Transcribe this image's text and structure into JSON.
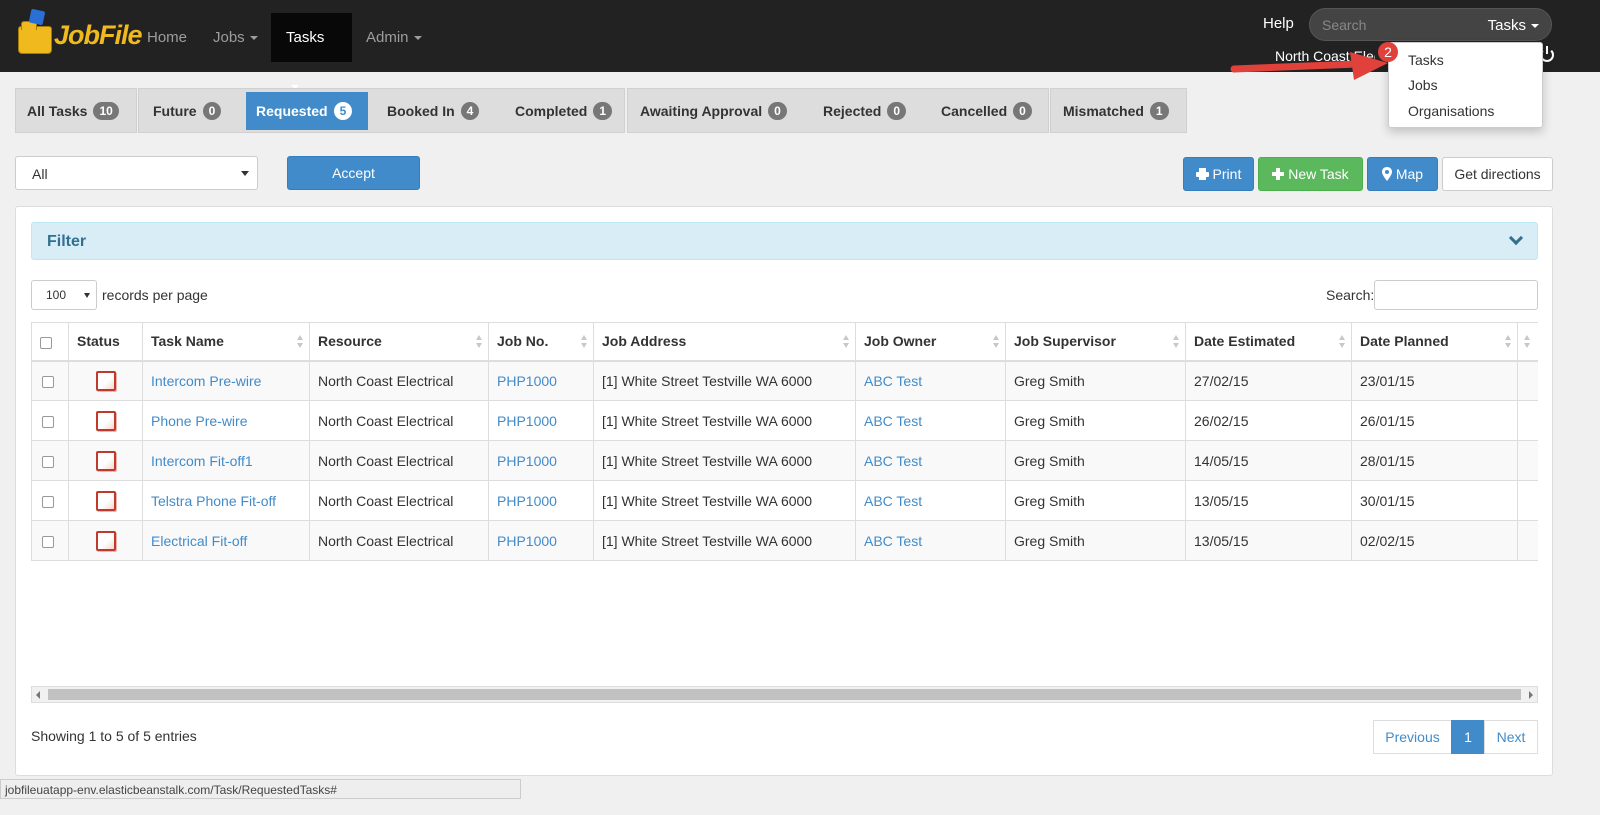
{
  "app": {
    "logo_text": "JobFile"
  },
  "nav": {
    "home": "Home",
    "jobs": "Jobs",
    "tasks": "Tasks",
    "admin": "Admin",
    "help": "Help",
    "search_placeholder": "Search",
    "search_scope": "Tasks",
    "user": "North Coast Elec"
  },
  "dropdown": {
    "items": [
      "Tasks",
      "Jobs",
      "Organisations"
    ],
    "annotation_number": "2"
  },
  "tabs": [
    {
      "label": "All Tasks",
      "count": "10"
    },
    {
      "label": "Future",
      "count": "0"
    },
    {
      "label": "Requested",
      "count": "5"
    },
    {
      "label": "Booked In",
      "count": "4"
    },
    {
      "label": "Completed",
      "count": "1"
    },
    {
      "label": "Awaiting Approval",
      "count": "0"
    },
    {
      "label": "Rejected",
      "count": "0"
    },
    {
      "label": "Cancelled",
      "count": "0"
    },
    {
      "label": "Mismatched",
      "count": "1"
    }
  ],
  "actions": {
    "select_value": "All",
    "accept": "Accept",
    "print": "Print",
    "new_task": "New Task",
    "map": "Map",
    "directions": "Get directions"
  },
  "filter": {
    "title": "Filter"
  },
  "table_controls": {
    "per_page": "100",
    "per_page_label": "records per page",
    "search_label": "Search:"
  },
  "table": {
    "headers": [
      "Status",
      "Task Name",
      "Resource",
      "Job No.",
      "Job Address",
      "Job Owner",
      "Job Supervisor",
      "Date Estimated",
      "Date Planned"
    ],
    "rows": [
      {
        "task": "Intercom Pre-wire",
        "resource": "North Coast Electrical",
        "job_no": "PHP1000",
        "address": "[1] White Street Testville WA 6000",
        "owner": "ABC Test",
        "supervisor": "Greg Smith",
        "estimated": "27/02/15",
        "planned": "23/01/15"
      },
      {
        "task": "Phone Pre-wire",
        "resource": "North Coast Electrical",
        "job_no": "PHP1000",
        "address": "[1] White Street Testville WA 6000",
        "owner": "ABC Test",
        "supervisor": "Greg Smith",
        "estimated": "26/02/15",
        "planned": "26/01/15"
      },
      {
        "task": "Intercom Fit-off1",
        "resource": "North Coast Electrical",
        "job_no": "PHP1000",
        "address": "[1] White Street Testville WA 6000",
        "owner": "ABC Test",
        "supervisor": "Greg Smith",
        "estimated": "14/05/15",
        "planned": "28/01/15"
      },
      {
        "task": "Telstra Phone Fit-off",
        "resource": "North Coast Electrical",
        "job_no": "PHP1000",
        "address": "[1] White Street Testville WA 6000",
        "owner": "ABC Test",
        "supervisor": "Greg Smith",
        "estimated": "13/05/15",
        "planned": "30/01/15"
      },
      {
        "task": "Electrical Fit-off",
        "resource": "North Coast Electrical",
        "job_no": "PHP1000",
        "address": "[1] White Street Testville WA 6000",
        "owner": "ABC Test",
        "supervisor": "Greg Smith",
        "estimated": "13/05/15",
        "planned": "02/02/15"
      }
    ]
  },
  "footer": {
    "showing": "Showing 1 to 5 of 5 entries",
    "previous": "Previous",
    "page": "1",
    "next": "Next"
  },
  "statusbar": {
    "url": "jobfileuatapp-env.elasticbeanstalk.com/Task/RequestedTasks#"
  },
  "colors": {
    "primary": "#428bca",
    "success": "#5cb85c",
    "navbar": "#222222",
    "annotation": "#e0413a"
  }
}
